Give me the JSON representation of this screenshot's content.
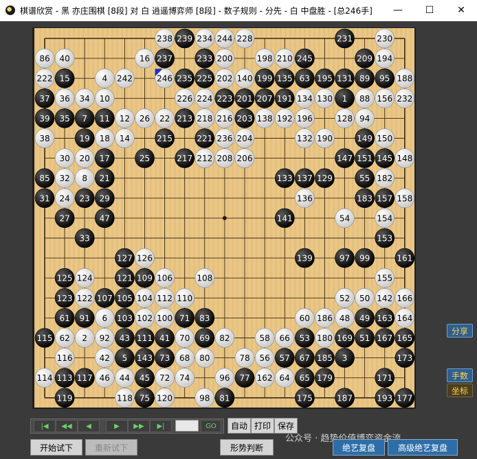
{
  "window": {
    "title": "棋谱欣赏 - 黑 亦庄围棋 [8段] 对 白 逍遥博弈师 [8段] - 数子规则 - 分先 - 白 中盘胜 - [总246手]",
    "min_icon": "minimize-icon",
    "max_icon": "maximize-icon",
    "close_icon": "close-icon"
  },
  "board": {
    "size": 19,
    "star_points": [
      [
        9,
        9
      ]
    ],
    "last_move_marker": [
      6,
      2
    ],
    "stones": [
      {
        "c": 6,
        "r": 0,
        "col": "w",
        "n": "238"
      },
      {
        "c": 7,
        "r": 0,
        "col": "b",
        "n": "239"
      },
      {
        "c": 8,
        "r": 0,
        "col": "w",
        "n": "234"
      },
      {
        "c": 9,
        "r": 0,
        "col": "w",
        "n": "244"
      },
      {
        "c": 10,
        "r": 0,
        "col": "w",
        "n": "228"
      },
      {
        "c": 15,
        "r": 0,
        "col": "b",
        "n": "231"
      },
      {
        "c": 17,
        "r": 0,
        "col": "w",
        "n": "230"
      },
      {
        "c": 0,
        "r": 1,
        "col": "w",
        "n": "86"
      },
      {
        "c": 1,
        "r": 1,
        "col": "w",
        "n": "40"
      },
      {
        "c": 5,
        "r": 1,
        "col": "w",
        "n": "16"
      },
      {
        "c": 6,
        "r": 1,
        "col": "b",
        "n": "237"
      },
      {
        "c": 8,
        "r": 1,
        "col": "b",
        "n": "233"
      },
      {
        "c": 9,
        "r": 1,
        "col": "w",
        "n": "200"
      },
      {
        "c": 11,
        "r": 1,
        "col": "w",
        "n": "198"
      },
      {
        "c": 12,
        "r": 1,
        "col": "w",
        "n": "210"
      },
      {
        "c": 13,
        "r": 1,
        "col": "b",
        "n": "245"
      },
      {
        "c": 16,
        "r": 1,
        "col": "b",
        "n": "209"
      },
      {
        "c": 17,
        "r": 1,
        "col": "w",
        "n": "194"
      },
      {
        "c": 0,
        "r": 2,
        "col": "w",
        "n": "222"
      },
      {
        "c": 1,
        "r": 2,
        "col": "b",
        "n": "15"
      },
      {
        "c": 3,
        "r": 2,
        "col": "w",
        "n": "4"
      },
      {
        "c": 4,
        "r": 2,
        "col": "w",
        "n": "242"
      },
      {
        "c": 6,
        "r": 2,
        "col": "w",
        "n": "246"
      },
      {
        "c": 7,
        "r": 2,
        "col": "b",
        "n": "235"
      },
      {
        "c": 8,
        "r": 2,
        "col": "b",
        "n": "225"
      },
      {
        "c": 9,
        "r": 2,
        "col": "w",
        "n": "202"
      },
      {
        "c": 10,
        "r": 2,
        "col": "w",
        "n": "140"
      },
      {
        "c": 11,
        "r": 2,
        "col": "b",
        "n": "199"
      },
      {
        "c": 12,
        "r": 2,
        "col": "b",
        "n": "135"
      },
      {
        "c": 13,
        "r": 2,
        "col": "b",
        "n": "63"
      },
      {
        "c": 14,
        "r": 2,
        "col": "b",
        "n": "195"
      },
      {
        "c": 15,
        "r": 2,
        "col": "b",
        "n": "131"
      },
      {
        "c": 16,
        "r": 2,
        "col": "b",
        "n": "89"
      },
      {
        "c": 17,
        "r": 2,
        "col": "b",
        "n": "95"
      },
      {
        "c": 18,
        "r": 2,
        "col": "w",
        "n": "188"
      },
      {
        "c": 0,
        "r": 3,
        "col": "b",
        "n": "37"
      },
      {
        "c": 1,
        "r": 3,
        "col": "w",
        "n": "36"
      },
      {
        "c": 2,
        "r": 3,
        "col": "w",
        "n": "34"
      },
      {
        "c": 3,
        "r": 3,
        "col": "w",
        "n": "10"
      },
      {
        "c": 7,
        "r": 3,
        "col": "w",
        "n": "226"
      },
      {
        "c": 8,
        "r": 3,
        "col": "w",
        "n": "224"
      },
      {
        "c": 9,
        "r": 3,
        "col": "b",
        "n": "223"
      },
      {
        "c": 10,
        "r": 3,
        "col": "b",
        "n": "201"
      },
      {
        "c": 11,
        "r": 3,
        "col": "b",
        "n": "207"
      },
      {
        "c": 12,
        "r": 3,
        "col": "b",
        "n": "191"
      },
      {
        "c": 13,
        "r": 3,
        "col": "w",
        "n": "134"
      },
      {
        "c": 14,
        "r": 3,
        "col": "w",
        "n": "130"
      },
      {
        "c": 15,
        "r": 3,
        "col": "b",
        "n": "1"
      },
      {
        "c": 16,
        "r": 3,
        "col": "w",
        "n": "88"
      },
      {
        "c": 17,
        "r": 3,
        "col": "w",
        "n": "156"
      },
      {
        "c": 18,
        "r": 3,
        "col": "w",
        "n": "232"
      },
      {
        "c": 0,
        "r": 4,
        "col": "b",
        "n": "39"
      },
      {
        "c": 1,
        "r": 4,
        "col": "b",
        "n": "35"
      },
      {
        "c": 2,
        "r": 4,
        "col": "b",
        "n": "7"
      },
      {
        "c": 3,
        "r": 4,
        "col": "b",
        "n": "11"
      },
      {
        "c": 4,
        "r": 4,
        "col": "w",
        "n": "12"
      },
      {
        "c": 5,
        "r": 4,
        "col": "w",
        "n": "26"
      },
      {
        "c": 6,
        "r": 4,
        "col": "w",
        "n": "22"
      },
      {
        "c": 7,
        "r": 4,
        "col": "b",
        "n": "213"
      },
      {
        "c": 8,
        "r": 4,
        "col": "w",
        "n": "218"
      },
      {
        "c": 9,
        "r": 4,
        "col": "w",
        "n": "216"
      },
      {
        "c": 10,
        "r": 4,
        "col": "b",
        "n": "203"
      },
      {
        "c": 11,
        "r": 4,
        "col": "w",
        "n": "138"
      },
      {
        "c": 12,
        "r": 4,
        "col": "w",
        "n": "192"
      },
      {
        "c": 13,
        "r": 4,
        "col": "w",
        "n": "196"
      },
      {
        "c": 15,
        "r": 4,
        "col": "w",
        "n": "128"
      },
      {
        "c": 16,
        "r": 4,
        "col": "w",
        "n": "94"
      },
      {
        "c": 0,
        "r": 5,
        "col": "w",
        "n": "38"
      },
      {
        "c": 2,
        "r": 5,
        "col": "b",
        "n": "19"
      },
      {
        "c": 3,
        "r": 5,
        "col": "w",
        "n": "18"
      },
      {
        "c": 4,
        "r": 5,
        "col": "w",
        "n": "14"
      },
      {
        "c": 6,
        "r": 5,
        "col": "b",
        "n": "215"
      },
      {
        "c": 8,
        "r": 5,
        "col": "b",
        "n": "221"
      },
      {
        "c": 9,
        "r": 5,
        "col": "w",
        "n": "236"
      },
      {
        "c": 10,
        "r": 5,
        "col": "w",
        "n": "204"
      },
      {
        "c": 13,
        "r": 5,
        "col": "w",
        "n": "132"
      },
      {
        "c": 14,
        "r": 5,
        "col": "w",
        "n": "190"
      },
      {
        "c": 16,
        "r": 5,
        "col": "b",
        "n": "149"
      },
      {
        "c": 17,
        "r": 5,
        "col": "w",
        "n": "150"
      },
      {
        "c": 1,
        "r": 6,
        "col": "w",
        "n": "30"
      },
      {
        "c": 2,
        "r": 6,
        "col": "w",
        "n": "20"
      },
      {
        "c": 3,
        "r": 6,
        "col": "b",
        "n": "17"
      },
      {
        "c": 5,
        "r": 6,
        "col": "b",
        "n": "25"
      },
      {
        "c": 7,
        "r": 6,
        "col": "b",
        "n": "217"
      },
      {
        "c": 8,
        "r": 6,
        "col": "w",
        "n": "212"
      },
      {
        "c": 9,
        "r": 6,
        "col": "w",
        "n": "208"
      },
      {
        "c": 10,
        "r": 6,
        "col": "w",
        "n": "206"
      },
      {
        "c": 15,
        "r": 6,
        "col": "b",
        "n": "147"
      },
      {
        "c": 16,
        "r": 6,
        "col": "b",
        "n": "151"
      },
      {
        "c": 17,
        "r": 6,
        "col": "b",
        "n": "145"
      },
      {
        "c": 18,
        "r": 6,
        "col": "w",
        "n": "148"
      },
      {
        "c": 0,
        "r": 7,
        "col": "b",
        "n": "85"
      },
      {
        "c": 1,
        "r": 7,
        "col": "w",
        "n": "32"
      },
      {
        "c": 2,
        "r": 7,
        "col": "w",
        "n": "8"
      },
      {
        "c": 3,
        "r": 7,
        "col": "b",
        "n": "21"
      },
      {
        "c": 12,
        "r": 7,
        "col": "b",
        "n": "133"
      },
      {
        "c": 13,
        "r": 7,
        "col": "b",
        "n": "137"
      },
      {
        "c": 14,
        "r": 7,
        "col": "b",
        "n": "129"
      },
      {
        "c": 16,
        "r": 7,
        "col": "b",
        "n": "55"
      },
      {
        "c": 17,
        "r": 7,
        "col": "w",
        "n": "182"
      },
      {
        "c": 0,
        "r": 8,
        "col": "b",
        "n": "31"
      },
      {
        "c": 1,
        "r": 8,
        "col": "w",
        "n": "24"
      },
      {
        "c": 2,
        "r": 8,
        "col": "b",
        "n": "23"
      },
      {
        "c": 3,
        "r": 8,
        "col": "b",
        "n": "29"
      },
      {
        "c": 13,
        "r": 8,
        "col": "w",
        "n": "136"
      },
      {
        "c": 16,
        "r": 8,
        "col": "b",
        "n": "183"
      },
      {
        "c": 17,
        "r": 8,
        "col": "b",
        "n": "157"
      },
      {
        "c": 18,
        "r": 8,
        "col": "w",
        "n": "158"
      },
      {
        "c": 1,
        "r": 9,
        "col": "b",
        "n": "27"
      },
      {
        "c": 3,
        "r": 9,
        "col": "b",
        "n": "47"
      },
      {
        "c": 12,
        "r": 9,
        "col": "b",
        "n": "141"
      },
      {
        "c": 15,
        "r": 9,
        "col": "w",
        "n": "54"
      },
      {
        "c": 17,
        "r": 9,
        "col": "w",
        "n": "154"
      },
      {
        "c": 2,
        "r": 10,
        "col": "b",
        "n": "33"
      },
      {
        "c": 17,
        "r": 10,
        "col": "b",
        "n": "153"
      },
      {
        "c": 4,
        "r": 11,
        "col": "b",
        "n": "127"
      },
      {
        "c": 5,
        "r": 11,
        "col": "w",
        "n": "126"
      },
      {
        "c": 13,
        "r": 11,
        "col": "b",
        "n": "139"
      },
      {
        "c": 15,
        "r": 11,
        "col": "b",
        "n": "97"
      },
      {
        "c": 16,
        "r": 11,
        "col": "b",
        "n": "99"
      },
      {
        "c": 18,
        "r": 11,
        "col": "b",
        "n": "161"
      },
      {
        "c": 1,
        "r": 12,
        "col": "b",
        "n": "125"
      },
      {
        "c": 2,
        "r": 12,
        "col": "w",
        "n": "124"
      },
      {
        "c": 4,
        "r": 12,
        "col": "b",
        "n": "121"
      },
      {
        "c": 5,
        "r": 12,
        "col": "b",
        "n": "109"
      },
      {
        "c": 6,
        "r": 12,
        "col": "w",
        "n": "106"
      },
      {
        "c": 8,
        "r": 12,
        "col": "w",
        "n": "108"
      },
      {
        "c": 17,
        "r": 12,
        "col": "w",
        "n": "155"
      },
      {
        "c": 1,
        "r": 13,
        "col": "b",
        "n": "123"
      },
      {
        "c": 2,
        "r": 13,
        "col": "w",
        "n": "122"
      },
      {
        "c": 3,
        "r": 13,
        "col": "b",
        "n": "107"
      },
      {
        "c": 4,
        "r": 13,
        "col": "b",
        "n": "105"
      },
      {
        "c": 5,
        "r": 13,
        "col": "w",
        "n": "104"
      },
      {
        "c": 6,
        "r": 13,
        "col": "w",
        "n": "112"
      },
      {
        "c": 7,
        "r": 13,
        "col": "w",
        "n": "110"
      },
      {
        "c": 15,
        "r": 13,
        "col": "w",
        "n": "52"
      },
      {
        "c": 16,
        "r": 13,
        "col": "w",
        "n": "50"
      },
      {
        "c": 17,
        "r": 13,
        "col": "w",
        "n": "142"
      },
      {
        "c": 18,
        "r": 13,
        "col": "w",
        "n": "166"
      },
      {
        "c": 1,
        "r": 14,
        "col": "b",
        "n": "61"
      },
      {
        "c": 2,
        "r": 14,
        "col": "b",
        "n": "91"
      },
      {
        "c": 3,
        "r": 14,
        "col": "w",
        "n": "6"
      },
      {
        "c": 4,
        "r": 14,
        "col": "b",
        "n": "103"
      },
      {
        "c": 5,
        "r": 14,
        "col": "w",
        "n": "102"
      },
      {
        "c": 6,
        "r": 14,
        "col": "w",
        "n": "100"
      },
      {
        "c": 7,
        "r": 14,
        "col": "b",
        "n": "71"
      },
      {
        "c": 8,
        "r": 14,
        "col": "b",
        "n": "83"
      },
      {
        "c": 13,
        "r": 14,
        "col": "w",
        "n": "60"
      },
      {
        "c": 14,
        "r": 14,
        "col": "w",
        "n": "186"
      },
      {
        "c": 15,
        "r": 14,
        "col": "w",
        "n": "48"
      },
      {
        "c": 16,
        "r": 14,
        "col": "b",
        "n": "49"
      },
      {
        "c": 17,
        "r": 14,
        "col": "b",
        "n": "163"
      },
      {
        "c": 18,
        "r": 14,
        "col": "w",
        "n": "164"
      },
      {
        "c": 0,
        "r": 15,
        "col": "b",
        "n": "115"
      },
      {
        "c": 1,
        "r": 15,
        "col": "w",
        "n": "62"
      },
      {
        "c": 2,
        "r": 15,
        "col": "w",
        "n": "2"
      },
      {
        "c": 3,
        "r": 15,
        "col": "w",
        "n": "92"
      },
      {
        "c": 4,
        "r": 15,
        "col": "b",
        "n": "43"
      },
      {
        "c": 5,
        "r": 15,
        "col": "b",
        "n": "111"
      },
      {
        "c": 6,
        "r": 15,
        "col": "b",
        "n": "41"
      },
      {
        "c": 7,
        "r": 15,
        "col": "w",
        "n": "70"
      },
      {
        "c": 8,
        "r": 15,
        "col": "b",
        "n": "69"
      },
      {
        "c": 9,
        "r": 15,
        "col": "w",
        "n": "82"
      },
      {
        "c": 11,
        "r": 15,
        "col": "w",
        "n": "58"
      },
      {
        "c": 12,
        "r": 15,
        "col": "w",
        "n": "66"
      },
      {
        "c": 13,
        "r": 15,
        "col": "b",
        "n": "53"
      },
      {
        "c": 14,
        "r": 15,
        "col": "w",
        "n": "180"
      },
      {
        "c": 15,
        "r": 15,
        "col": "b",
        "n": "169"
      },
      {
        "c": 16,
        "r": 15,
        "col": "b",
        "n": "51"
      },
      {
        "c": 17,
        "r": 15,
        "col": "b",
        "n": "167"
      },
      {
        "c": 18,
        "r": 15,
        "col": "b",
        "n": "165"
      },
      {
        "c": 1,
        "r": 16,
        "col": "w",
        "n": "116"
      },
      {
        "c": 3,
        "r": 16,
        "col": "w",
        "n": "42"
      },
      {
        "c": 4,
        "r": 16,
        "col": "b",
        "n": "5"
      },
      {
        "c": 5,
        "r": 16,
        "col": "b",
        "n": "143"
      },
      {
        "c": 6,
        "r": 16,
        "col": "b",
        "n": "73"
      },
      {
        "c": 7,
        "r": 16,
        "col": "w",
        "n": "68"
      },
      {
        "c": 8,
        "r": 16,
        "col": "w",
        "n": "80"
      },
      {
        "c": 10,
        "r": 16,
        "col": "w",
        "n": "78"
      },
      {
        "c": 11,
        "r": 16,
        "col": "w",
        "n": "56"
      },
      {
        "c": 12,
        "r": 16,
        "col": "b",
        "n": "57"
      },
      {
        "c": 13,
        "r": 16,
        "col": "b",
        "n": "67"
      },
      {
        "c": 14,
        "r": 16,
        "col": "b",
        "n": "185"
      },
      {
        "c": 15,
        "r": 16,
        "col": "b",
        "n": "3"
      },
      {
        "c": 18,
        "r": 16,
        "col": "b",
        "n": "173"
      },
      {
        "c": 0,
        "r": 17,
        "col": "w",
        "n": "114"
      },
      {
        "c": 1,
        "r": 17,
        "col": "b",
        "n": "113"
      },
      {
        "c": 2,
        "r": 17,
        "col": "b",
        "n": "117"
      },
      {
        "c": 3,
        "r": 17,
        "col": "w",
        "n": "46"
      },
      {
        "c": 4,
        "r": 17,
        "col": "w",
        "n": "44"
      },
      {
        "c": 5,
        "r": 17,
        "col": "b",
        "n": "45"
      },
      {
        "c": 6,
        "r": 17,
        "col": "w",
        "n": "72"
      },
      {
        "c": 7,
        "r": 17,
        "col": "w",
        "n": "74"
      },
      {
        "c": 9,
        "r": 17,
        "col": "w",
        "n": "96"
      },
      {
        "c": 10,
        "r": 17,
        "col": "b",
        "n": "77"
      },
      {
        "c": 11,
        "r": 17,
        "col": "w",
        "n": "162"
      },
      {
        "c": 12,
        "r": 17,
        "col": "w",
        "n": "64"
      },
      {
        "c": 13,
        "r": 17,
        "col": "b",
        "n": "65"
      },
      {
        "c": 14,
        "r": 17,
        "col": "b",
        "n": "179"
      },
      {
        "c": 17,
        "r": 17,
        "col": "b",
        "n": "171"
      },
      {
        "c": 1,
        "r": 18,
        "col": "b",
        "n": "119"
      },
      {
        "c": 4,
        "r": 18,
        "col": "w",
        "n": "118"
      },
      {
        "c": 5,
        "r": 18,
        "col": "b",
        "n": "75"
      },
      {
        "c": 6,
        "r": 18,
        "col": "w",
        "n": "120"
      },
      {
        "c": 8,
        "r": 18,
        "col": "w",
        "n": "98"
      },
      {
        "c": 9,
        "r": 18,
        "col": "b",
        "n": "81"
      },
      {
        "c": 13,
        "r": 18,
        "col": "b",
        "n": "175"
      },
      {
        "c": 15,
        "r": 18,
        "col": "b",
        "n": "187"
      },
      {
        "c": 17,
        "r": 18,
        "col": "b",
        "n": "193"
      },
      {
        "c": 18,
        "r": 18,
        "col": "b",
        "n": "177"
      }
    ]
  },
  "controls": {
    "nav_first": "|◀",
    "nav_prev10": "◀◀",
    "nav_prev": "◀",
    "nav_next": "▶",
    "nav_next10": "▶▶",
    "nav_last": "▶|",
    "go": "GO",
    "auto": "自动",
    "print": "打印",
    "save": "保存",
    "start_trial": "开始试下",
    "restart_trial": "重新试下",
    "position_judgment": "形势判断",
    "masterpiece_review": "绝艺复盘",
    "advanced_review": "高级绝艺复盘"
  },
  "side": {
    "share": "分享",
    "move_number": "手数",
    "coordinates": "坐标"
  },
  "watermark": "公众号 · 趋势价值博弈资金流",
  "colors": {
    "board": "#e9c582",
    "accent_blue": "#2e6ea8",
    "nav_green": "#6ad06a"
  }
}
